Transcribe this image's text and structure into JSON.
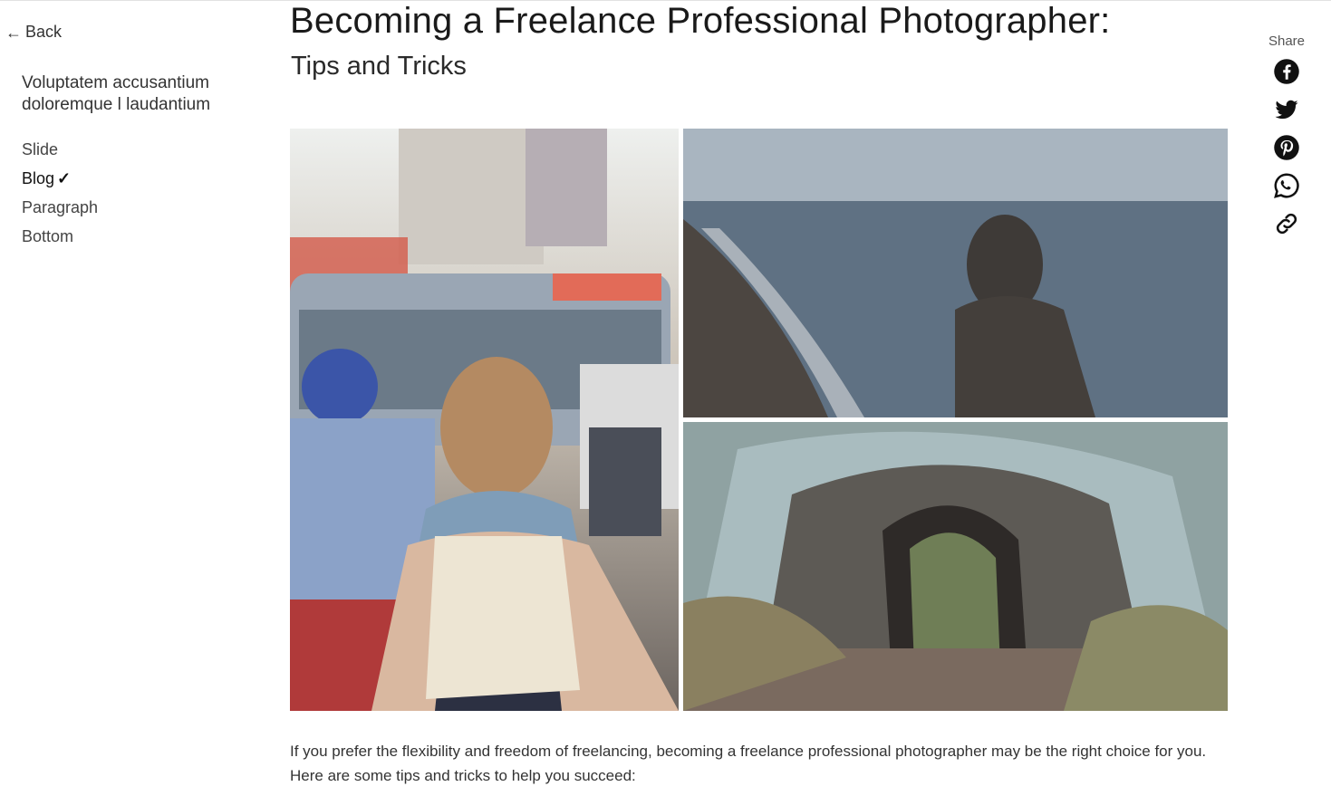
{
  "nav": {
    "back_label": "Back",
    "section_title": "Voluptatem accusantium doloremque l laudantium",
    "items": [
      {
        "label": "Slide",
        "active": false
      },
      {
        "label": "Blog",
        "active": true,
        "marker": "✓"
      },
      {
        "label": "Paragraph",
        "active": false
      },
      {
        "label": "Bottom",
        "active": false
      }
    ]
  },
  "article": {
    "title": "Becoming a Freelance Professional Photographer:",
    "subtitle": "Tips and Tricks",
    "intro": "If you prefer the flexibility and freedom of freelancing, becoming a freelance professional photographer may be the right choice for you. Here are some tips and tricks to help you succeed:",
    "photos": [
      {
        "icon": "street-photo",
        "subject": "woman with backpack on busy street"
      },
      {
        "icon": "seashore-photo",
        "subject": "hooded person by the sea"
      },
      {
        "icon": "rock-arch-photo",
        "subject": "rock arch in forest"
      }
    ]
  },
  "share": {
    "label": "Share",
    "buttons": [
      "facebook-icon",
      "twitter-icon",
      "pinterest-icon",
      "whatsapp-icon",
      "link-icon"
    ]
  }
}
